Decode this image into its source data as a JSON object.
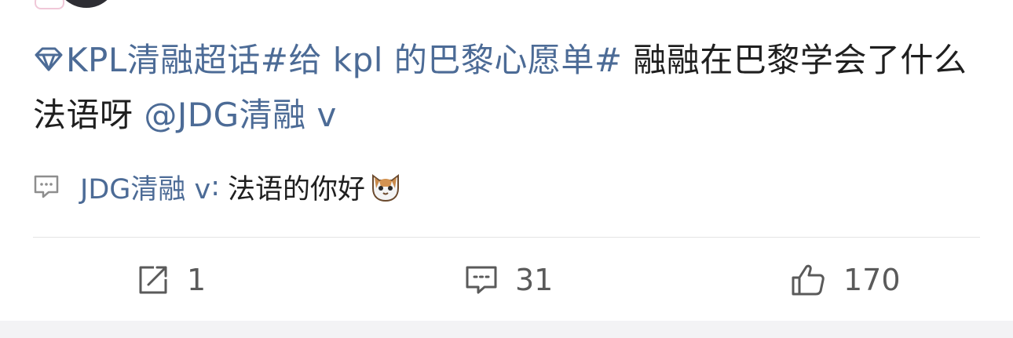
{
  "post": {
    "topic_tag": "KPL清融超话",
    "hashtag": "#给 kpl 的巴黎心愿单#",
    "text_part1": " 融融在巴黎学会了什么法语呀 ",
    "mention": "@JDG清融 v"
  },
  "comment_preview": {
    "author": "JDG清融 v",
    "colon": ":",
    "text": " 法语的你好",
    "emoji": "cat-face-emoji"
  },
  "actions": {
    "repost_count": "1",
    "comment_count": "31",
    "like_count": "170"
  },
  "colors": {
    "link": "#4c6b96",
    "text": "#1f1f1f",
    "icon": "#5a5a5a",
    "divider": "#e4e4e4"
  }
}
